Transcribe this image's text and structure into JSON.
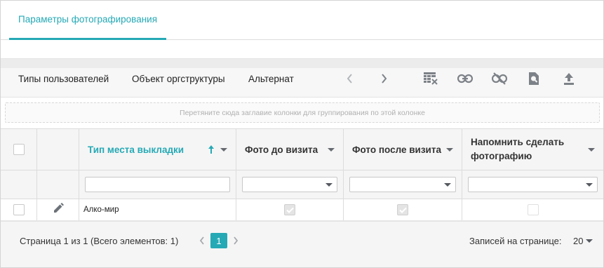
{
  "tabs": [
    {
      "label": "Параметры фотографирования",
      "active": true
    }
  ],
  "toolbar": {
    "buttons": [
      {
        "label": "Типы пользователей"
      },
      {
        "label": "Объект оргструктуры"
      },
      {
        "label": "Альтернат"
      }
    ],
    "icons": [
      "chevron-left-icon",
      "chevron-right-icon",
      "table-clear-icon",
      "link-icon",
      "unlink-icon",
      "search-document-icon",
      "upload-icon"
    ]
  },
  "group_zone": {
    "text": "Перетяните сюда заглавие колонки для группирования по этой колонке"
  },
  "grid": {
    "columns": [
      {
        "label": "Тип места выкладки",
        "sorted": "asc",
        "accent": "#25a9b5"
      },
      {
        "label": "Фото до визита"
      },
      {
        "label": "Фото после визита"
      },
      {
        "label": "Напомнить сделать фотографию"
      }
    ],
    "filters": {
      "type_value": "",
      "before_value": "",
      "after_value": "",
      "remind_value": ""
    },
    "rows": [
      {
        "type": "Алко-мир",
        "before": true,
        "after": true,
        "remind": false
      }
    ]
  },
  "footer": {
    "page_info": "Страница 1 из 1 (Всего элементов: 1)",
    "current_page": "1",
    "page_size_label": "Записей на странице:",
    "page_size": "20"
  },
  "colors": {
    "accent": "#25a9b5",
    "header_bg": "#f5f5f5",
    "border": "#dcdcdc"
  }
}
